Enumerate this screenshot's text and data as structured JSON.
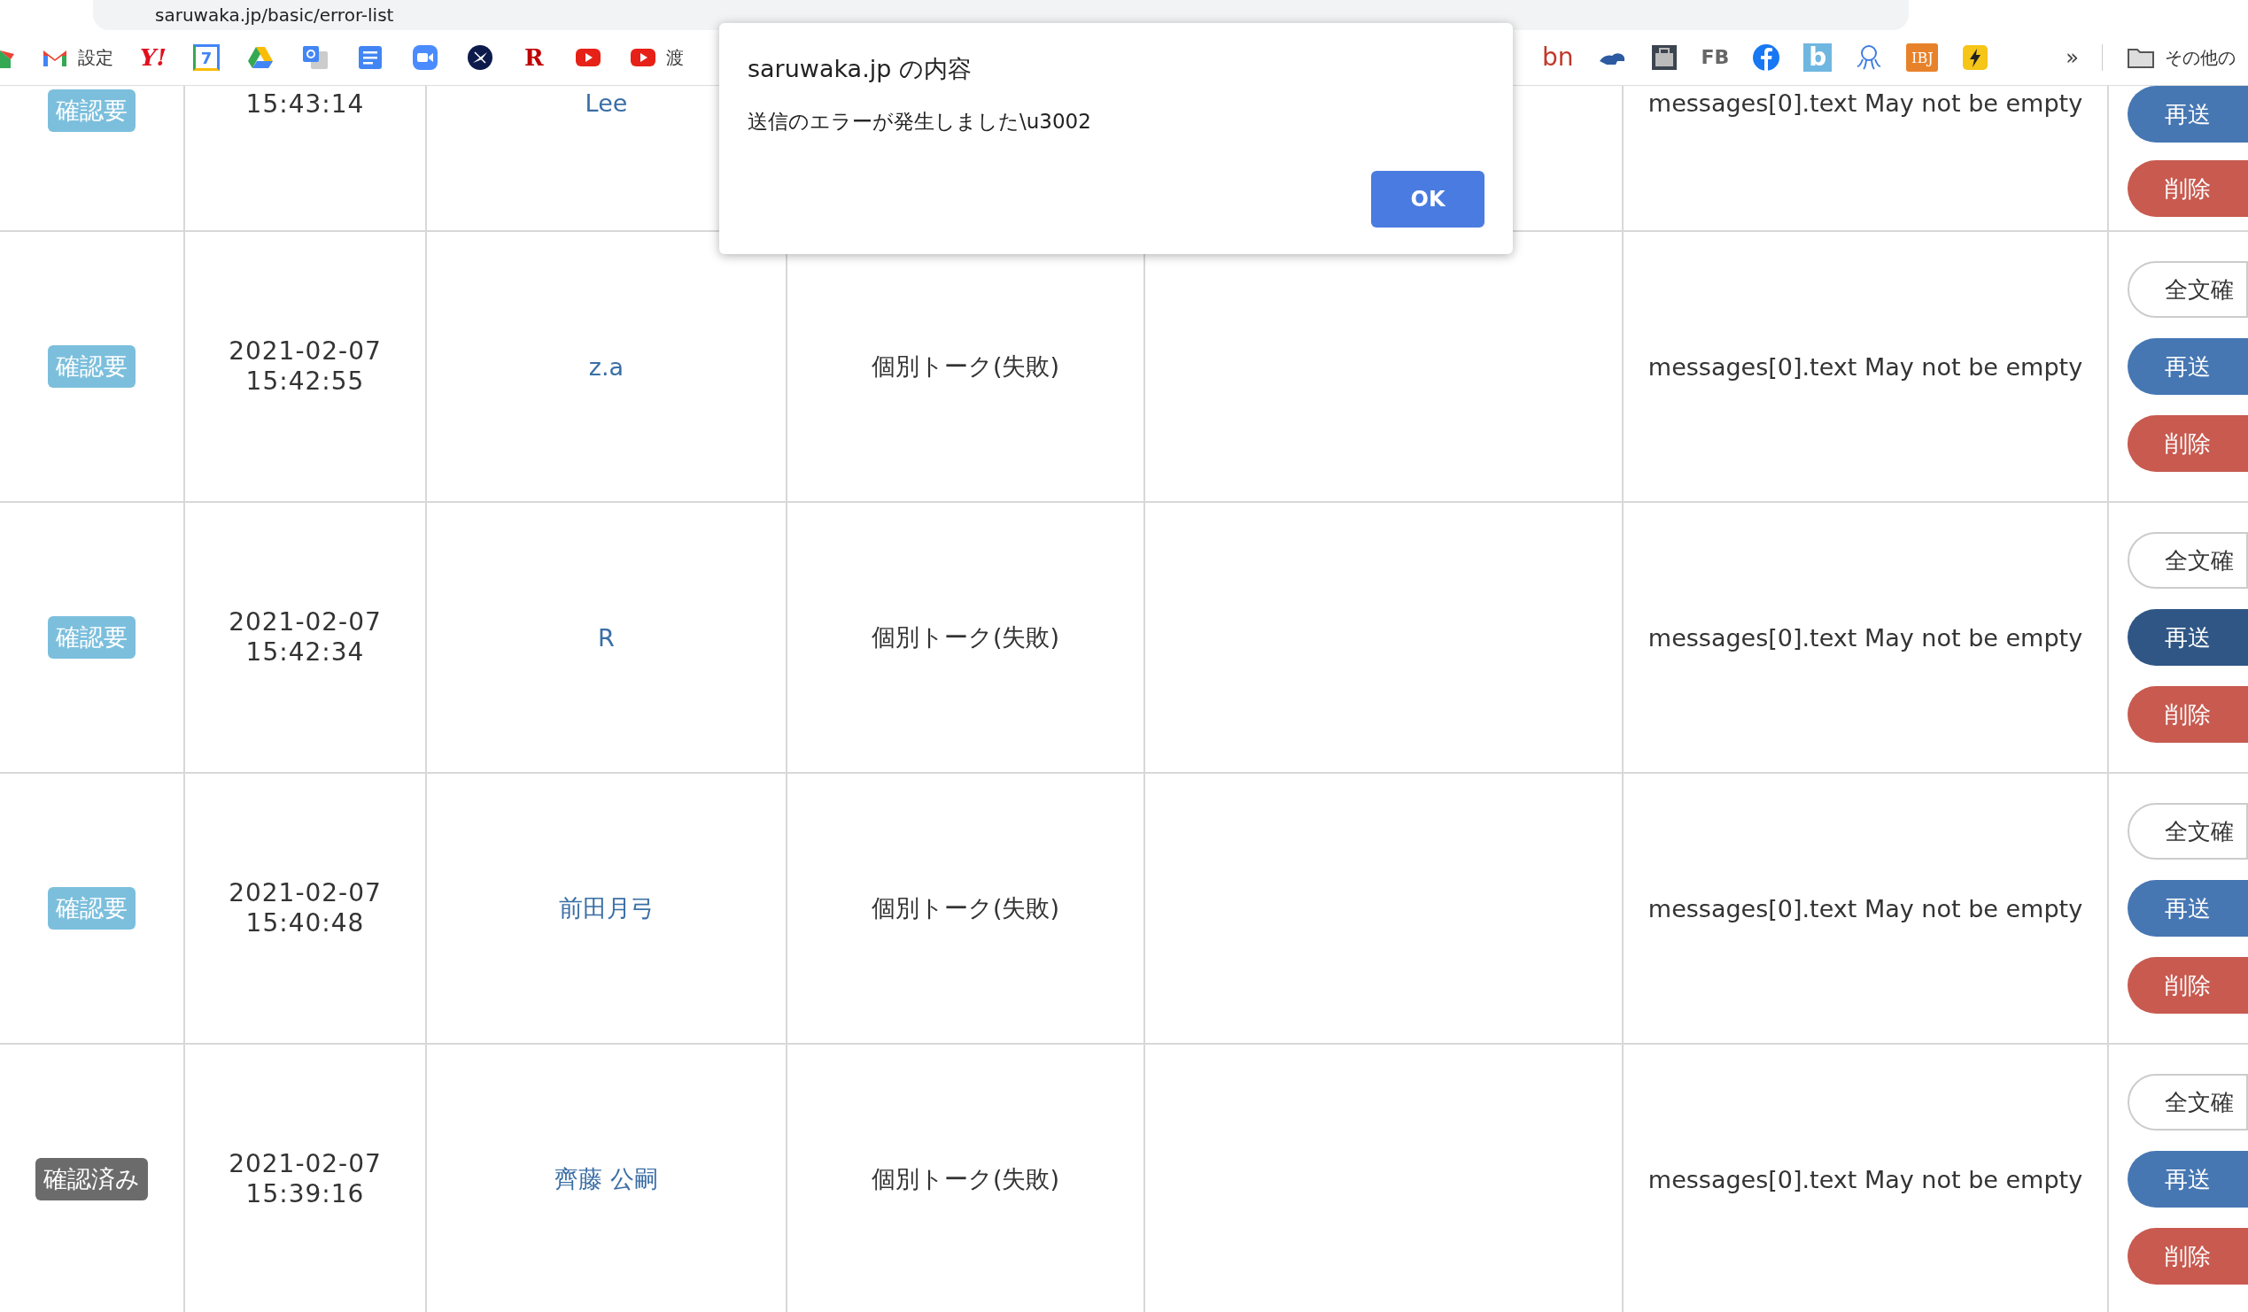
{
  "browser": {
    "address": "saruwaka.jp/basic/error-list",
    "bookmarks_left": [
      {
        "kind": "mail-partial"
      },
      {
        "kind": "gmail",
        "label": "設定"
      },
      {
        "kind": "yahoo",
        "label": "Y!"
      },
      {
        "kind": "calendar",
        "label": "7"
      },
      {
        "kind": "drive"
      },
      {
        "kind": "translate"
      },
      {
        "kind": "docs"
      },
      {
        "kind": "video"
      },
      {
        "kind": "compass"
      },
      {
        "kind": "letter-logo",
        "label": "R"
      },
      {
        "kind": "play"
      },
      {
        "kind": "play",
        "label": "渡"
      }
    ],
    "bookmarks_right": [
      {
        "kind": "text-logo",
        "label": "bn"
      },
      {
        "kind": "dino"
      },
      {
        "kind": "briefcase"
      },
      {
        "kind": "text",
        "label": "FB"
      },
      {
        "kind": "facebook"
      },
      {
        "kind": "b-logo",
        "label": "b"
      },
      {
        "kind": "octopus"
      },
      {
        "kind": "ibj",
        "label": "IBJ"
      },
      {
        "kind": "bolt"
      }
    ],
    "more": "»",
    "other_bookmarks": "その他の"
  },
  "table": {
    "rows": [
      {
        "status": {
          "label": "確認要",
          "kind": "pending"
        },
        "time": "15:43:14",
        "name": "Lee",
        "error": "messages[0].text May not be empty",
        "actions": [
          {
            "label": "再送",
            "kind": "resend",
            "focused": false
          },
          {
            "label": "削除",
            "kind": "delete",
            "focused": false
          }
        ]
      },
      {
        "status": {
          "label": "確認要",
          "kind": "pending"
        },
        "date": "2021-02-07",
        "time": "15:42:55",
        "name": "z.a",
        "type": "個別トーク(失敗)",
        "error": "messages[0].text May not be empty",
        "actions": [
          {
            "label": "全文確",
            "kind": "view",
            "focused": false
          },
          {
            "label": "再送",
            "kind": "resend",
            "focused": false
          },
          {
            "label": "削除",
            "kind": "delete",
            "focused": false
          }
        ]
      },
      {
        "status": {
          "label": "確認要",
          "kind": "pending"
        },
        "date": "2021-02-07",
        "time": "15:42:34",
        "name": "R",
        "type": "個別トーク(失敗)",
        "error": "messages[0].text May not be empty",
        "actions": [
          {
            "label": "全文確",
            "kind": "view",
            "focused": false
          },
          {
            "label": "再送",
            "kind": "resend",
            "focused": true
          },
          {
            "label": "削除",
            "kind": "delete",
            "focused": false
          }
        ]
      },
      {
        "status": {
          "label": "確認要",
          "kind": "pending"
        },
        "date": "2021-02-07",
        "time": "15:40:48",
        "name": "前田月弓",
        "type": "個別トーク(失敗)",
        "error": "messages[0].text May not be empty",
        "actions": [
          {
            "label": "全文確",
            "kind": "view",
            "focused": false
          },
          {
            "label": "再送",
            "kind": "resend",
            "focused": false
          },
          {
            "label": "削除",
            "kind": "delete",
            "focused": false
          }
        ]
      },
      {
        "status": {
          "label": "確認済み",
          "kind": "done"
        },
        "date": "2021-02-07",
        "time": "15:39:16",
        "name": "齊藤 公嗣",
        "type": "個別トーク(失敗)",
        "error": "messages[0].text May not be empty",
        "actions": [
          {
            "label": "全文確",
            "kind": "view",
            "focused": false
          },
          {
            "label": "再送",
            "kind": "resend",
            "focused": false
          },
          {
            "label": "削除",
            "kind": "delete",
            "focused": false
          }
        ]
      }
    ]
  },
  "dialog": {
    "title": "saruwaka.jp の内容",
    "message": "送信のエラーが発生しました\\u3002",
    "button": "OK"
  }
}
